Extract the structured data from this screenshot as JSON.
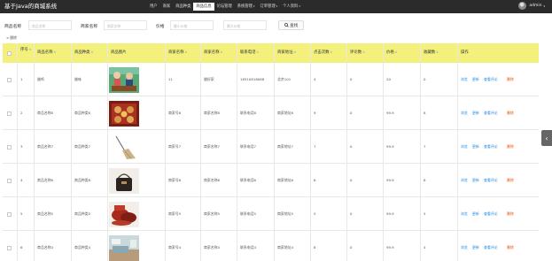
{
  "app": {
    "title": "基于Java的商城系统"
  },
  "nav": [
    {
      "label": "用户",
      "caret": false
    },
    {
      "label": "商家",
      "caret": false
    },
    {
      "label": "商品种类",
      "caret": false
    },
    {
      "label": "商品信息",
      "caret": false,
      "active": true
    },
    {
      "label": "论坛管理",
      "caret": false
    },
    {
      "label": "系统管理",
      "caret": true
    },
    {
      "label": "订单管理",
      "caret": true
    },
    {
      "label": "个人资料",
      "caret": true
    }
  ],
  "user": {
    "name": "admin",
    "caret": "▾"
  },
  "search": {
    "fields": [
      {
        "label": "商品名称",
        "placeholder": "商品名称"
      },
      {
        "label": "商家名称",
        "placeholder": "商家名称"
      },
      {
        "label": "价格",
        "placeholder": "最小价格"
      },
      {
        "label": "",
        "placeholder": "最大价格"
      }
    ],
    "button_label": "查找",
    "button_icon": "search-icon"
  },
  "toolbar": {
    "delete_label": "删除"
  },
  "table": {
    "headers": [
      "序号",
      "商品名称",
      "商品种类",
      "商品图片",
      "商家名称",
      "商家名称",
      "联系电话",
      "商家地址",
      "点击次数",
      "评论数",
      "价格",
      "收藏数",
      "操作"
    ],
    "sortable": [
      true,
      true,
      true,
      false,
      true,
      true,
      true,
      true,
      true,
      true,
      true,
      true,
      false
    ],
    "rows": [
      {
        "index": "1",
        "name": "腊鸡",
        "category": "腊味",
        "image": "laji",
        "shop_id": "11",
        "shop_name": "腊好家",
        "phone": "18510818088",
        "address": "北京101",
        "clicks": "4",
        "comments": "0",
        "price": "20",
        "favorites": "0"
      },
      {
        "index": "2",
        "name": "商品名称8",
        "category": "商品种类8",
        "image": "mooncake",
        "shop_id": "商家号8",
        "shop_name": "商家名称8",
        "phone": "联系电话8",
        "address": "商家地址8",
        "clicks": "9",
        "comments": "0",
        "price": "99.9",
        "favorites": "8"
      },
      {
        "index": "3",
        "name": "商品名称7",
        "category": "商品种类7",
        "image": "broom",
        "shop_id": "商家号7",
        "shop_name": "商家名称7",
        "phone": "联系电话7",
        "address": "商家地址7",
        "clicks": "7",
        "comments": "0",
        "price": "99.9",
        "favorites": "7"
      },
      {
        "index": "4",
        "name": "商品名称6",
        "category": "商品种类6",
        "image": "bag",
        "shop_id": "商家号6",
        "shop_name": "商家名称6",
        "phone": "联系电话6",
        "address": "商家地址6",
        "clicks": "6",
        "comments": "0",
        "price": "99.9",
        "favorites": "6"
      },
      {
        "index": "5",
        "name": "商品名称5",
        "category": "商品种类5",
        "image": "snack",
        "shop_id": "商家号5",
        "shop_name": "商家名称5",
        "phone": "联系电话5",
        "address": "商家地址5",
        "clicks": "5",
        "comments": "0",
        "price": "99.9",
        "favorites": "5"
      },
      {
        "index": "6",
        "name": "商品名称4",
        "category": "商品种类4",
        "image": "room",
        "shop_id": "商家号4",
        "shop_name": "商家名称4",
        "phone": "联系电话4",
        "address": "商家地址4",
        "clicks": "6",
        "comments": "0",
        "price": "99.9",
        "favorites": "4"
      }
    ],
    "actions": [
      {
        "label": "浏览",
        "color": "#1e88e5"
      },
      {
        "label": "更新",
        "color": "#1e88e5"
      },
      {
        "label": "查看评论",
        "color": "#1e88e5"
      },
      {
        "label": "删除",
        "color": "#e65100"
      }
    ]
  },
  "colors": {
    "topbar": "#2b2b2b",
    "table_header": "#f3f07c",
    "link": "#1e88e5",
    "delete": "#e65100"
  },
  "side_tab": {
    "icon": "chevron-left-icon",
    "glyph": "‹"
  }
}
